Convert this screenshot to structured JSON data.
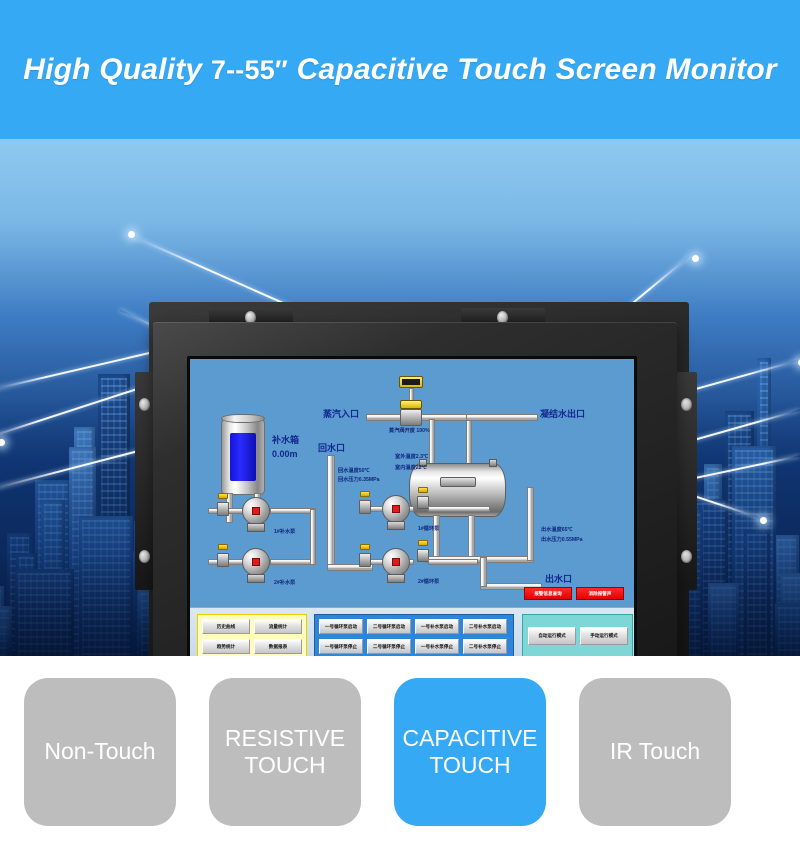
{
  "banner": {
    "text_before": "High Quality ",
    "size_range": "7--55″",
    "text_after": " Capacitive Touch Screen Monitor",
    "bg_color": "#36a9f4",
    "text_color": "#ffffff"
  },
  "hero": {
    "alt": "Blue night cityscape with network connection lines",
    "product": "Open frame capacitive touch screen monitor with metal mounting brackets"
  },
  "hmi": {
    "screen_bg": "#5b9bd0",
    "labels": {
      "steam_inlet": "蒸汽入口",
      "steam_valve_opening": "蒸汽阀开度 100%",
      "condensate_outlet": "凝结水出口",
      "tank_name": "补水箱",
      "tank_level": "0.00m",
      "return_inlet": "回水口",
      "return_temp": "回水温度50℃",
      "return_pressure": "回水压力0.35MPa",
      "outdoor_temp": "室外温度2.3℃",
      "indoor_temp": "室内温度22℃",
      "supply_temp": "出水温度65℃",
      "supply_pressure": "出水压力0.55MPa",
      "supply_outlet": "出水口",
      "pump_makeup_1": "1#补水泵",
      "pump_makeup_2": "2#补水泵",
      "pump_circ_1": "1#循环泵",
      "pump_circ_2": "2#循环泵"
    },
    "alarm_buttons": [
      "报警信息查询",
      "消除报警声"
    ],
    "data_buttons": [
      "历史曲线",
      "流量统计",
      "趋势统计",
      "数据报表"
    ],
    "control_buttons": [
      "一号循环泵启动",
      "二号循环泵启动",
      "一号补水泵启动",
      "二号补水泵启动",
      "一号循环泵停止",
      "二号循环泵停止",
      "一号补水泵停止",
      "二号补水泵停止"
    ],
    "mode_buttons": [
      "自动运行模式",
      "手动运行模式"
    ]
  },
  "cards": [
    {
      "label": "Non-Touch",
      "active": false,
      "color": "#bdbdbd"
    },
    {
      "label": "RESISTIVE TOUCH",
      "active": false,
      "color": "#bdbdbd"
    },
    {
      "label": "CAPACITIVE TOUCH",
      "active": true,
      "color": "#36a9f4"
    },
    {
      "label": "IR Touch",
      "active": false,
      "color": "#bdbdbd"
    }
  ]
}
